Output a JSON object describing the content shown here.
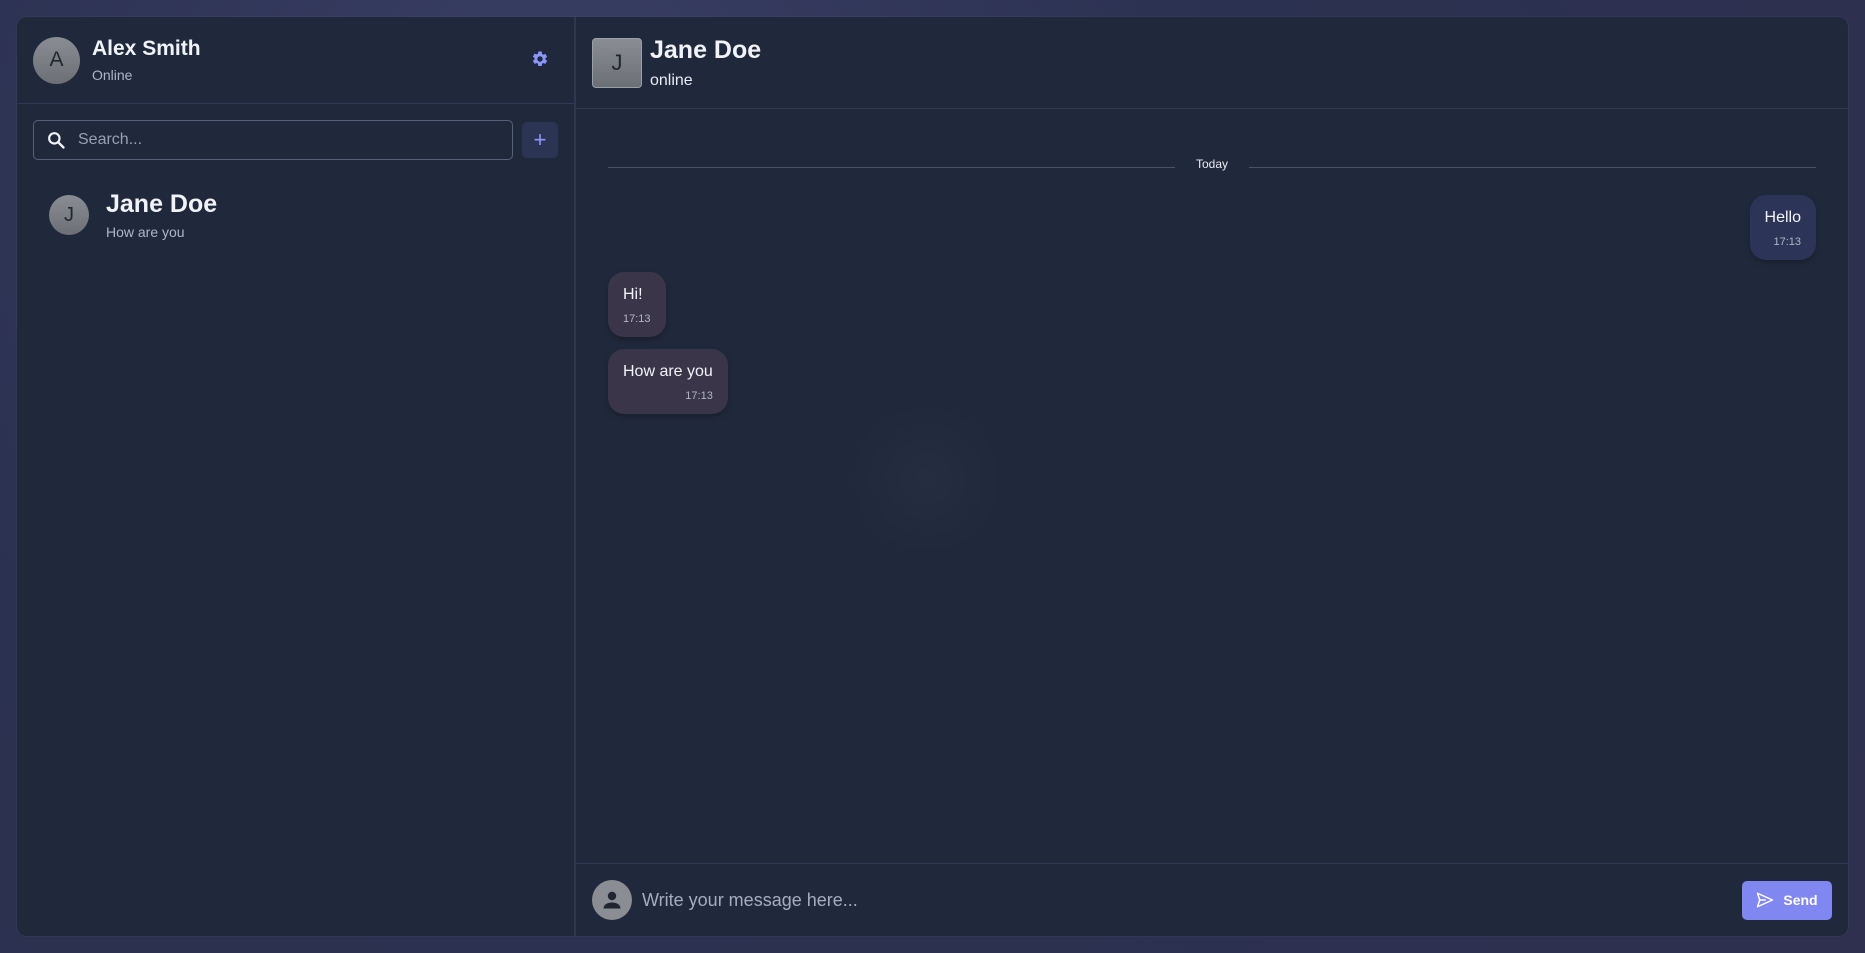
{
  "profile": {
    "avatar_initial": "A",
    "name": "Alex Smith",
    "status": "Online"
  },
  "sidebar": {
    "search_placeholder": "Search...",
    "add_label": "+",
    "contacts": [
      {
        "initial": "J",
        "name": "Jane Doe",
        "preview": "How are you"
      }
    ]
  },
  "chat_header": {
    "initial": "J",
    "name": "Jane Doe",
    "status": "online"
  },
  "messages": {
    "date_divider": "Today",
    "items": [
      {
        "direction": "out",
        "text": "Hello",
        "time": "17:13"
      },
      {
        "direction": "in",
        "text": "Hi!",
        "time": "17:13"
      },
      {
        "direction": "in",
        "text": "How are you",
        "time": "17:13"
      }
    ]
  },
  "composer": {
    "placeholder": "Write your message here...",
    "send_label": "Send"
  },
  "colors": {
    "accent": "#8187f0",
    "background": "#20293c",
    "outgoing_bubble": "#2c3557",
    "incoming_bubble": "#3a3548"
  },
  "icons": {
    "settings": "gear-icon",
    "search": "search-icon",
    "send": "send-icon",
    "user": "user-icon"
  }
}
